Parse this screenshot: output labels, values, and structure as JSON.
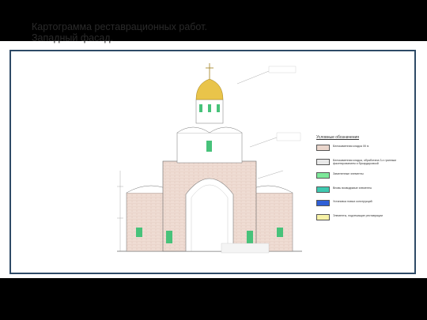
{
  "slide": {
    "title_line1": "Картограмма реставрационных работ.",
    "title_line2": "Западный фасад."
  },
  "legend": {
    "title": "Условные обозначения",
    "items": [
      {
        "label": "Белокаменная кладка XII в.",
        "color": "#ead6cc"
      },
      {
        "label": "Белокаменная кладка, обработана 3-х гранным фасетированием и бучардировкой",
        "color": "#e8e8e8"
      },
      {
        "label": "Замененные элементы",
        "color": "#7ee89a"
      },
      {
        "label": "Вновь возводимые элементы",
        "color": "#3ec9b0"
      },
      {
        "label": "Установка новых конструкций",
        "color": "#2f5fd6"
      },
      {
        "label": "Элементы, подлежащие реставрации",
        "color": "#f7f2a6"
      }
    ]
  },
  "colors": {
    "frame": "#2e4a66",
    "masonry": "#ead6cc",
    "green": "#47c27a",
    "dome": "#e9c44a",
    "line": "#555555"
  }
}
